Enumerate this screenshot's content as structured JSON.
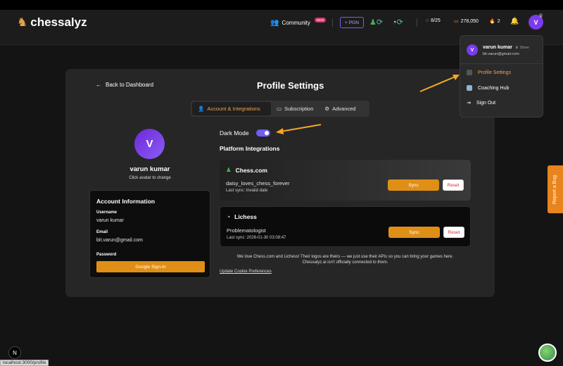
{
  "header": {
    "app_name": "chessalyz",
    "community_label": "Community",
    "new_badge": "NEW",
    "pgn_label": "PGN",
    "games_count": "8/25",
    "coins": "278,050",
    "streak": "2",
    "avatar_letter": "V"
  },
  "page": {
    "back_label": "Back to Dashboard",
    "title": "Profile Settings",
    "tabs": [
      {
        "label": "Account & Integrations"
      },
      {
        "label": "Subscription"
      },
      {
        "label": "Advanced"
      }
    ]
  },
  "profile": {
    "avatar_letter": "V",
    "name": "varun kumar",
    "hint": "Click avatar to change"
  },
  "account": {
    "title": "Account Information",
    "username_label": "Username",
    "username": "varun kumar",
    "email_label": "Email",
    "email": "bit.varun@gmail.com",
    "password_label": "Password",
    "google_btn": "Google Sign-In"
  },
  "settings": {
    "dark_mode_label": "Dark Mode",
    "platform_title": "Platform Integrations"
  },
  "platforms": [
    {
      "name": "Chess.com",
      "username": "daisy_loves_chess_forever",
      "last_sync": "Last sync: Invalid date",
      "sync": "Sync",
      "reset": "Reset"
    },
    {
      "name": "Lichess",
      "username": "Problematologist",
      "last_sync": "Last sync: 2026-01-30 03:08:47",
      "sync": "Sync",
      "reset": "Reset"
    }
  ],
  "disclaimer": {
    "line1": "We love Chess.com and Lichess! Their logos are theirs — we just use their APIs so you can bring your games here.",
    "line2": "Chessalyz.ai isn't officially connected to them.",
    "cookie_link": "Update Cookie Preferences"
  },
  "menu": {
    "avatar_letter": "V",
    "name": "varun kumar",
    "tier": "Silver",
    "email": "bit.varun@gmail.com",
    "items": [
      {
        "label": "Profile Settings"
      },
      {
        "label": "Coaching Hub"
      },
      {
        "label": "Sign Out"
      }
    ]
  },
  "report_bug": "Report a Bug",
  "status_url": "localhost:3000/profile",
  "next_badge": "N",
  "colors": {
    "accent_orange": "#e08f16",
    "purple": "#7c3aed",
    "background": "#141414",
    "card": "#262626"
  }
}
